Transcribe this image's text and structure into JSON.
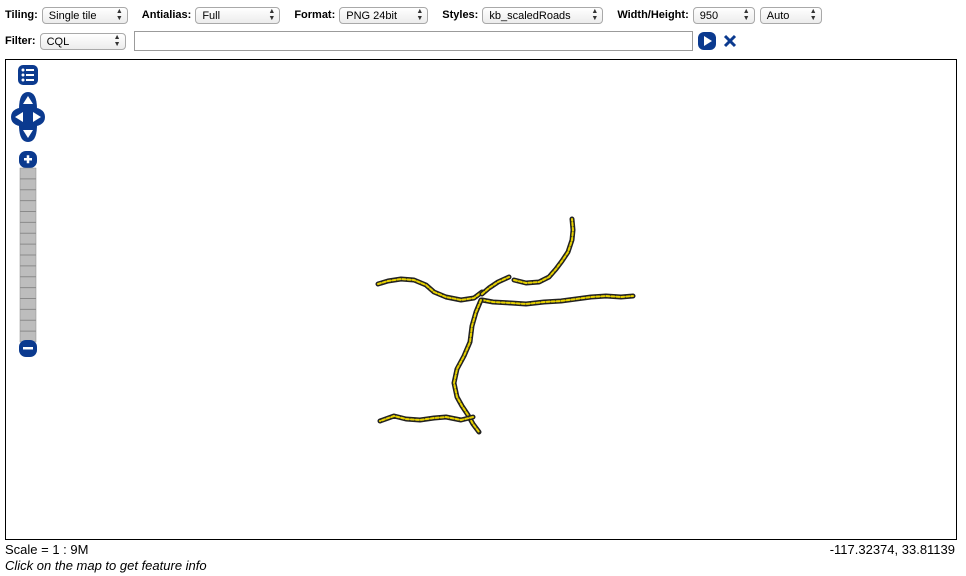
{
  "toolbar": {
    "tiling": {
      "label": "Tiling:",
      "value": "Single tile"
    },
    "antialias": {
      "label": "Antialias:",
      "value": "Full"
    },
    "format": {
      "label": "Format:",
      "value": "PNG 24bit"
    },
    "styles": {
      "label": "Styles:",
      "value": "kb_scaledRoads"
    },
    "size": {
      "label": "Width/Height:",
      "width": "950",
      "height": "Auto"
    },
    "filter": {
      "label": "Filter:",
      "type": "CQL",
      "value": ""
    }
  },
  "map": {
    "road_color": "#e8d200",
    "road_casing": "#222222",
    "control_color": "#0b3a8f",
    "zoom_bar_color": "#bdbdbd",
    "zoom_steps": 16
  },
  "status": {
    "scale": "Scale = 1 : 9M",
    "coordinates": "-117.32374, 33.81139",
    "hint": "Click on the map to get feature info"
  },
  "icons": {
    "apply": "play-icon",
    "reset": "close-icon",
    "layer_switcher": "list-icon",
    "pan": "pan-arrows-icon",
    "zoom_in": "plus-icon",
    "zoom_out": "minus-icon"
  }
}
